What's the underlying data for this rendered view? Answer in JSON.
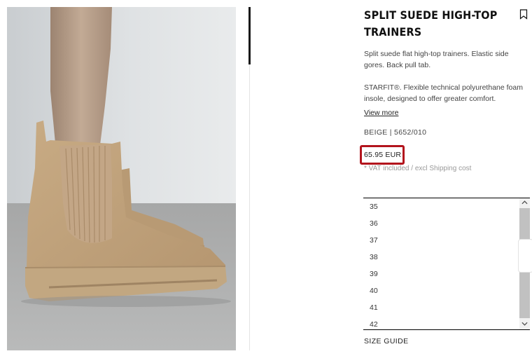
{
  "product": {
    "title_line1": "SPLIT SUEDE HIGH-TOP",
    "title_line2": "TRAINERS",
    "description_1_line1": "Split suede flat high-top trainers. Elastic side",
    "description_1_line2": "gores. Back pull tab.",
    "description_2_line1": "STARFIT®. Flexible technical polyurethane foam",
    "description_2_line2": "insole, designed to offer greater comfort.",
    "view_more": "View more",
    "color_ref": "BEIGE | 5652/010",
    "price": "65.95 EUR",
    "tax_note": "* VAT included / excl Shipping cost"
  },
  "sizes": [
    "35",
    "36",
    "37",
    "38",
    "39",
    "40",
    "41",
    "42"
  ],
  "size_guide": "SIZE GUIDE",
  "icons": {
    "bookmark": "bookmark-icon",
    "scroll_up": "chevron-up-icon",
    "scroll_down": "chevron-down-icon"
  },
  "colors": {
    "highlight": "#b3141d",
    "product": "#c8ab84"
  }
}
